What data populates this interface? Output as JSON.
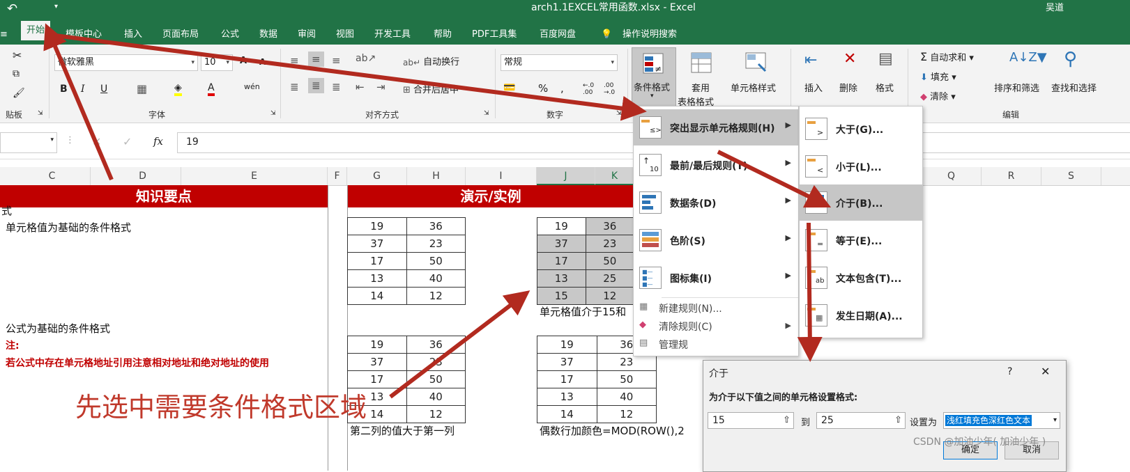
{
  "window": {
    "title": "arch1.1EXCEL常用函数.xlsx  -  Excel",
    "user": "吴道"
  },
  "tabs": [
    "开始",
    "模板中心",
    "插入",
    "页面布局",
    "公式",
    "数据",
    "审阅",
    "视图",
    "开发工具",
    "帮助",
    "PDF工具集",
    "百度网盘",
    "操作说明搜索"
  ],
  "ribbon": {
    "font_name": "微软雅黑",
    "font_size": "10",
    "wrap_text": "自动换行",
    "merge_center": "合并后居中",
    "number_format": "常规",
    "cond_format": "条件格式",
    "table_format_1": "套用",
    "table_format_2": "表格格式",
    "cell_style": "单元格样式",
    "insert": "插入",
    "delete": "删除",
    "format": "格式",
    "autosum": "自动求和",
    "fill": "填充",
    "clear": "清除",
    "sort_filter": "排序和筛选",
    "find_select": "查找和选择",
    "groups": {
      "clipboard": "贴板",
      "font": "字体",
      "alignment": "对齐方式",
      "number": "数字",
      "editing": "编辑"
    }
  },
  "formula_bar": {
    "fx": "fx",
    "value": "19"
  },
  "columns": [
    "C",
    "D",
    "E",
    "F",
    "G",
    "H",
    "I",
    "J",
    "K",
    "Q",
    "R",
    "S"
  ],
  "sheet": {
    "header_left": "知识要点",
    "header_right": "演示/实例",
    "text_1": "式",
    "text_2": "单元格值为基础的条件格式",
    "text_3": "公式为基础的条件格式",
    "note_label": "注:",
    "note_text": "若公式中存在单元格地址引用注意相对地址和绝对地址的使用",
    "caption_between": "单元格值介于15和",
    "caption_second": "第二列的值大于第一列",
    "caption_even": "偶数行加颜色=MOD(ROW(),2",
    "annotation": "先选中需要条件格式区域",
    "table_a": [
      [
        "19",
        "36"
      ],
      [
        "37",
        "23"
      ],
      [
        "17",
        "50"
      ],
      [
        "13",
        "40"
      ],
      [
        "14",
        "12"
      ]
    ],
    "table_b": [
      [
        "19",
        "36"
      ],
      [
        "37",
        "23"
      ],
      [
        "17",
        "50"
      ],
      [
        "13",
        "25"
      ],
      [
        "15",
        "12"
      ]
    ],
    "table_c": [
      [
        "19",
        "36"
      ],
      [
        "37",
        "23"
      ],
      [
        "17",
        "50"
      ],
      [
        "13",
        "40"
      ],
      [
        "14",
        "12"
      ]
    ],
    "table_d": [
      [
        "19",
        "36"
      ],
      [
        "37",
        "23"
      ],
      [
        "17",
        "50"
      ],
      [
        "13",
        "40"
      ],
      [
        "14",
        "12"
      ]
    ]
  },
  "cf_menu": [
    {
      "label": "突出显示单元格规则(H)",
      "submenu": true
    },
    {
      "label": "最前/最后规则(T)",
      "submenu": true
    },
    {
      "label": "数据条(D)",
      "submenu": true
    },
    {
      "label": "色阶(S)",
      "submenu": true
    },
    {
      "label": "图标集(I)",
      "submenu": true
    },
    {
      "label": "新建规则(N)...",
      "submenu": false
    },
    {
      "label": "清除规则(C)",
      "submenu": true
    },
    {
      "label": "管理规",
      "submenu": false
    }
  ],
  "highlight_submenu": [
    {
      "label": "大于(G)..."
    },
    {
      "label": "小于(L)..."
    },
    {
      "label": "介于(B)..."
    },
    {
      "label": "等于(E)..."
    },
    {
      "label": "文本包含(T)..."
    },
    {
      "label": "发生日期(A)..."
    }
  ],
  "dialog": {
    "title": "介于",
    "help": "?",
    "close": "✕",
    "prompt": "为介于以下值之间的单元格设置格式:",
    "from_value": "15",
    "to_label": "到",
    "to_value": "25",
    "set_as": "设置为",
    "format_option": "浅红填充色深红色文本",
    "ok": "确定",
    "cancel": "取消"
  },
  "watermark": "CSDN @加油少年( 加油少年 )",
  "colors": {
    "excel_green": "#217346",
    "header_red": "#c00000",
    "annotation_red": "#c0392b",
    "arrow_red": "#b22a1f"
  }
}
